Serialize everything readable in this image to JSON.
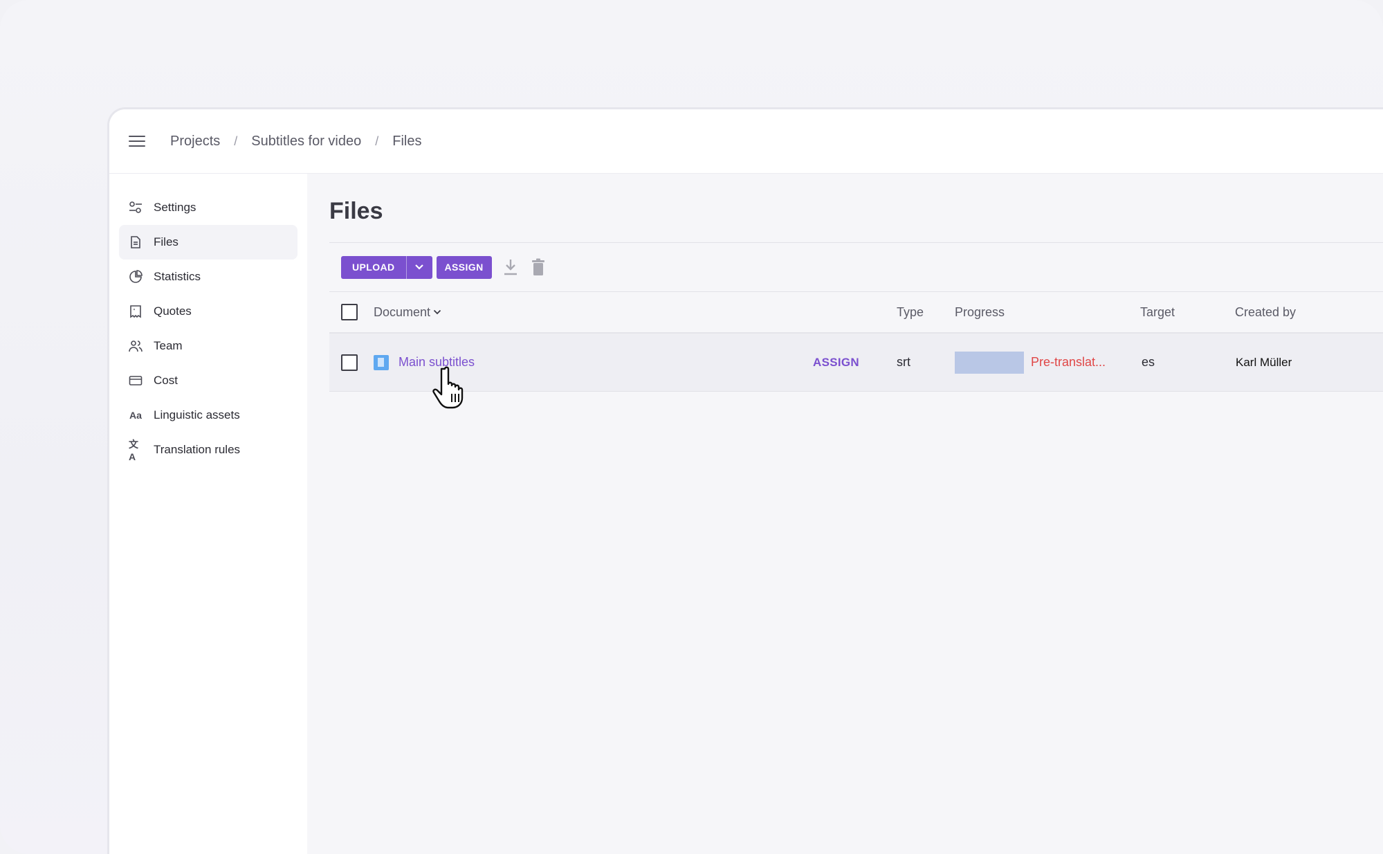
{
  "breadcrumb": {
    "projects": "Projects",
    "project": "Subtitles for video",
    "current": "Files",
    "separator": "/"
  },
  "sidebar": {
    "items": [
      {
        "label": "Settings",
        "icon": "settings-sliders-icon"
      },
      {
        "label": "Files",
        "icon": "file-icon",
        "active": true
      },
      {
        "label": "Statistics",
        "icon": "pie-chart-icon"
      },
      {
        "label": "Quotes",
        "icon": "quote-receipt-icon"
      },
      {
        "label": "Team",
        "icon": "team-icon"
      },
      {
        "label": "Cost",
        "icon": "credit-card-icon"
      },
      {
        "label": "Linguistic assets",
        "icon": "linguistic-aa-icon",
        "glyph": "Aa"
      },
      {
        "label": "Translation rules",
        "icon": "translate-icon",
        "glyph": "文A"
      }
    ]
  },
  "main": {
    "title": "Files"
  },
  "toolbar": {
    "upload_label": "UPLOAD",
    "assign_label": "ASSIGN"
  },
  "table": {
    "columns": {
      "document": "Document",
      "type": "Type",
      "progress": "Progress",
      "target": "Target",
      "created_by": "Created by"
    },
    "rows": [
      {
        "document": "Main subtitles",
        "assign": "ASSIGN",
        "type": "srt",
        "progress_status": "Pre-translat...",
        "target": "es",
        "created_by": "Karl Müller"
      }
    ]
  },
  "colors": {
    "accent": "#7b50cf",
    "status_error": "#e04646",
    "progress_fill": "#b9c7e6",
    "file_icon": "#5fa8f0"
  }
}
